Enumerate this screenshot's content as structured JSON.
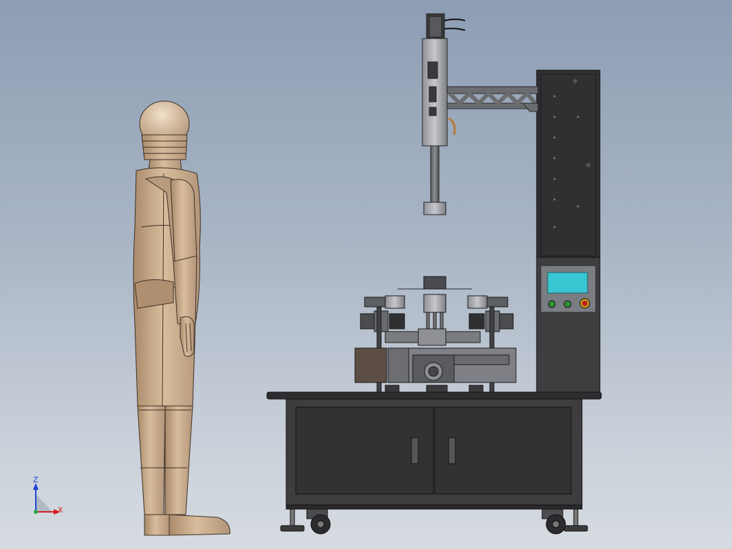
{
  "view": {
    "triad": {
      "z_label": "Z",
      "x_label": "X"
    },
    "colors": {
      "background_top": "#8d9db3",
      "background_bottom": "#d6dbe1",
      "mannequin": "#c9ab8a",
      "machine_dark": "#3a3a3c",
      "hmi_screen": "#38c6d2",
      "axis_z": "#1f3fd6",
      "axis_x": "#d62020"
    }
  }
}
